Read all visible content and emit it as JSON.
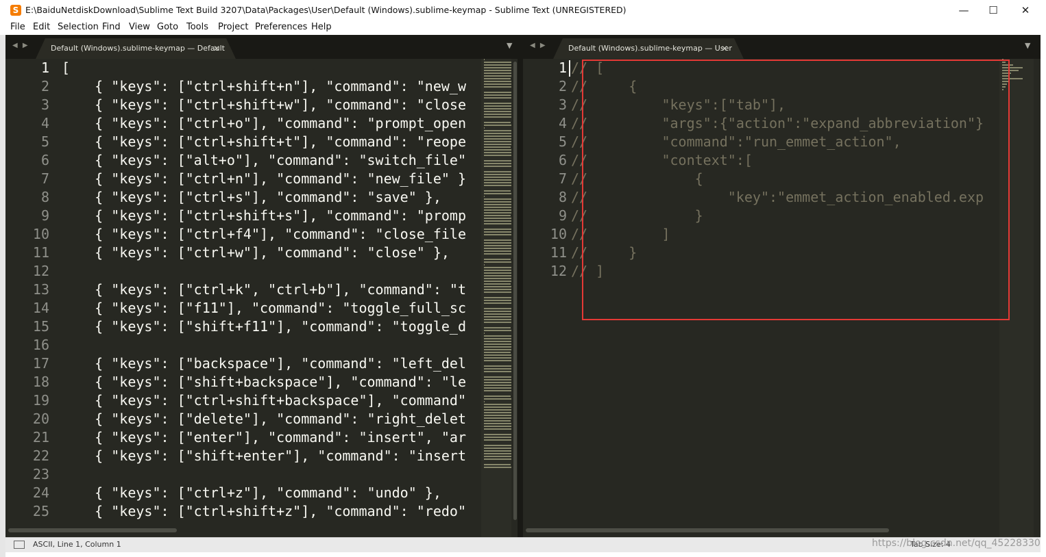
{
  "window": {
    "title": "E:\\BaiduNetdiskDownload\\Sublime Text Build 3207\\Data\\Packages\\User\\Default (Windows).sublime-keymap - Sublime Text (UNREGISTERED)",
    "minimize": "—",
    "maximize": "☐",
    "close": "✕"
  },
  "menu": [
    {
      "label": "File"
    },
    {
      "label": "Edit"
    },
    {
      "label": "Selection"
    },
    {
      "label": "Find"
    },
    {
      "label": "View"
    },
    {
      "label": "Goto"
    },
    {
      "label": "Tools"
    },
    {
      "label": "Project"
    },
    {
      "label": "Preferences"
    },
    {
      "label": "Help"
    }
  ],
  "left_pane": {
    "tab_label": "Default (Windows).sublime-keymap — Default",
    "line_numbers": [
      "1",
      "2",
      "3",
      "4",
      "5",
      "6",
      "7",
      "8",
      "9",
      "10",
      "11",
      "12",
      "13",
      "14",
      "15",
      "16",
      "17",
      "18",
      "19",
      "20",
      "21",
      "22",
      "23",
      "24",
      "25"
    ],
    "lines": [
      "[",
      "    { \"keys\": [\"ctrl+shift+n\"], \"command\": \"new_w",
      "    { \"keys\": [\"ctrl+shift+w\"], \"command\": \"close",
      "    { \"keys\": [\"ctrl+o\"], \"command\": \"prompt_open",
      "    { \"keys\": [\"ctrl+shift+t\"], \"command\": \"reope",
      "    { \"keys\": [\"alt+o\"], \"command\": \"switch_file\"",
      "    { \"keys\": [\"ctrl+n\"], \"command\": \"new_file\" }",
      "    { \"keys\": [\"ctrl+s\"], \"command\": \"save\" },",
      "    { \"keys\": [\"ctrl+shift+s\"], \"command\": \"promp",
      "    { \"keys\": [\"ctrl+f4\"], \"command\": \"close_file",
      "    { \"keys\": [\"ctrl+w\"], \"command\": \"close\" },",
      "",
      "    { \"keys\": [\"ctrl+k\", \"ctrl+b\"], \"command\": \"t",
      "    { \"keys\": [\"f11\"], \"command\": \"toggle_full_sc",
      "    { \"keys\": [\"shift+f11\"], \"command\": \"toggle_d",
      "",
      "    { \"keys\": [\"backspace\"], \"command\": \"left_del",
      "    { \"keys\": [\"shift+backspace\"], \"command\": \"le",
      "    { \"keys\": [\"ctrl+shift+backspace\"], \"command\"",
      "    { \"keys\": [\"delete\"], \"command\": \"right_delet",
      "    { \"keys\": [\"enter\"], \"command\": \"insert\", \"ar",
      "    { \"keys\": [\"shift+enter\"], \"command\": \"insert",
      "",
      "    { \"keys\": [\"ctrl+z\"], \"command\": \"undo\" },",
      "    { \"keys\": [\"ctrl+shift+z\"], \"command\": \"redo\""
    ]
  },
  "right_pane": {
    "tab_label": "Default (Windows).sublime-keymap — User",
    "line_numbers": [
      "1",
      "2",
      "3",
      "4",
      "5",
      "6",
      "7",
      "8",
      "9",
      "10",
      "11",
      "12"
    ],
    "lines": [
      "// [",
      "//     {",
      "//         \"keys\":[\"tab\"],",
      "//         \"args\":{\"action\":\"expand_abbreviation\"}",
      "//         \"command\":\"run_emmet_action\",",
      "//         \"context\":[",
      "//             {",
      "//                 \"key\":\"emmet_action_enabled.exp",
      "//             }",
      "//         ]",
      "//     }",
      "// ]"
    ]
  },
  "status": {
    "text": "ASCII, Line 1, Column 1",
    "right": "Tab Size: 4"
  },
  "watermark": "https://blog.csdn.net/qq_45228330",
  "colors": {
    "editor_bg": "#272822",
    "tabbar_bg": "#191915",
    "comment": "#75715e",
    "text": "#f8f8f2",
    "highlight_box": "#e53935"
  }
}
